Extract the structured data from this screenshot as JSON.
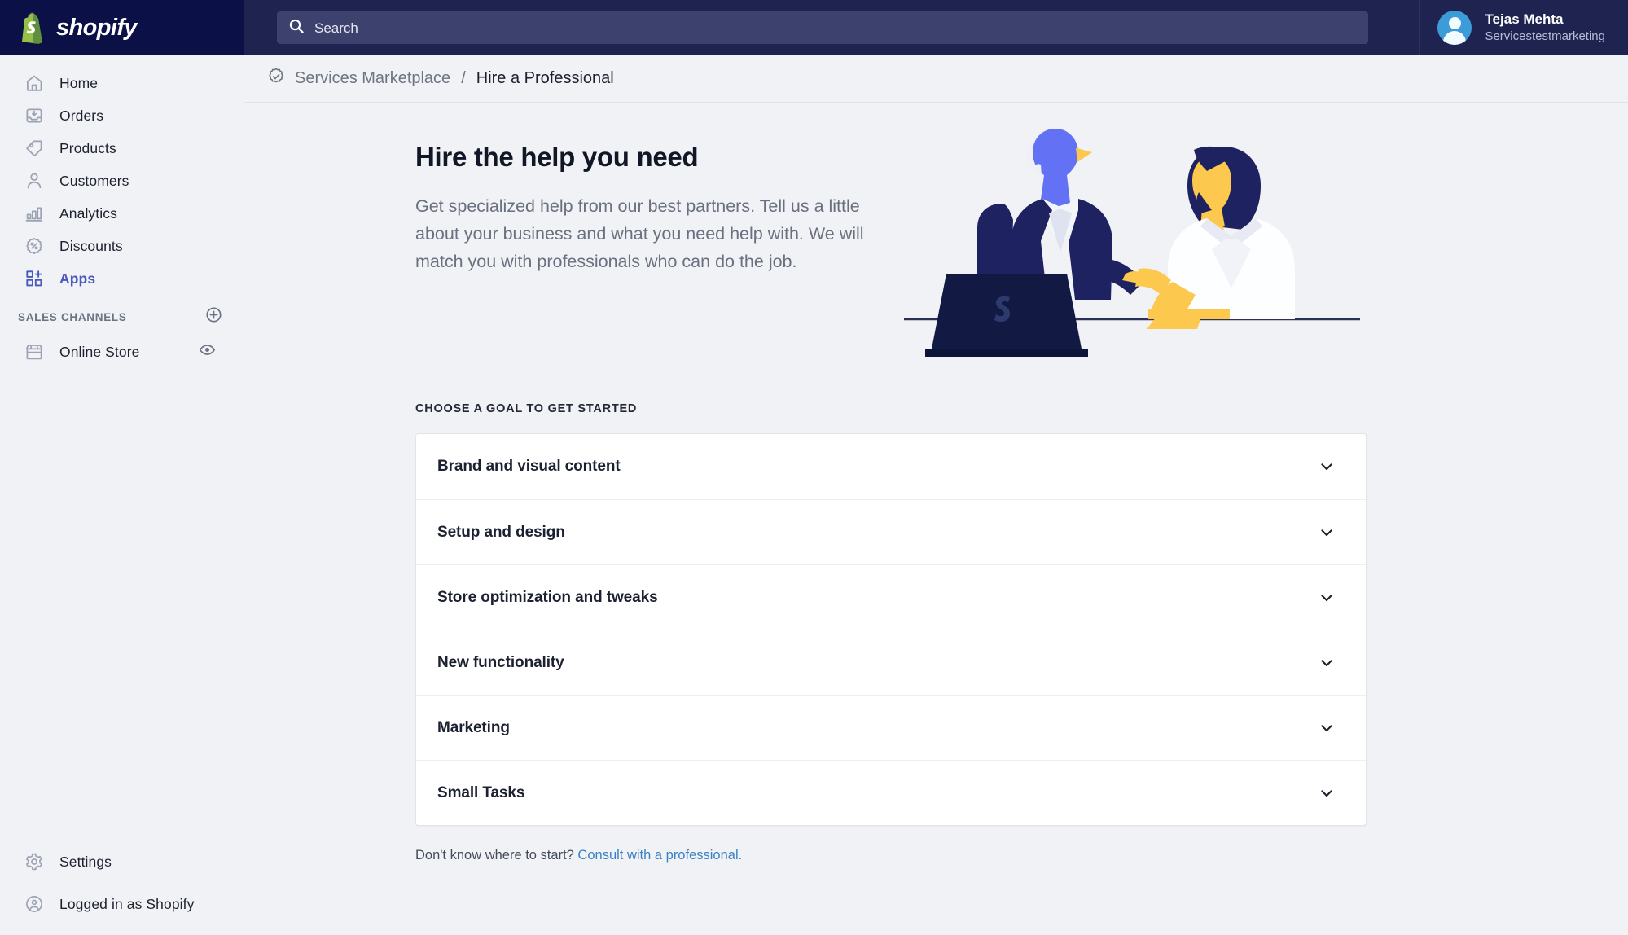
{
  "brand": {
    "name": "shopify",
    "logo_icon": "shopify-bag-icon",
    "topbar_color": "#1f2350",
    "logo_panel_color": "#0b1046",
    "accent_color": "#4959bd",
    "link_color": "#3b82c4",
    "page_background": "#f1f2f5"
  },
  "search": {
    "placeholder": "Search",
    "value": "",
    "icon": "search-icon"
  },
  "user": {
    "name": "Tejas Mehta",
    "store": "Servicestestmarketing",
    "avatar_icon": "user-avatar-icon"
  },
  "sidebar": {
    "items": [
      {
        "label": "Home",
        "icon": "home-icon",
        "active": false
      },
      {
        "label": "Orders",
        "icon": "orders-icon",
        "active": false
      },
      {
        "label": "Products",
        "icon": "tag-icon",
        "active": false
      },
      {
        "label": "Customers",
        "icon": "person-icon",
        "active": false
      },
      {
        "label": "Analytics",
        "icon": "bar-chart-icon",
        "active": false
      },
      {
        "label": "Discounts",
        "icon": "discount-icon",
        "active": false
      },
      {
        "label": "Apps",
        "icon": "apps-grid-icon",
        "active": true
      }
    ],
    "sales_channels": {
      "title": "SALES CHANNELS",
      "add_icon": "plus-circle-icon",
      "items": [
        {
          "label": "Online Store",
          "icon": "storefront-icon",
          "action_icon": "eye-icon"
        }
      ]
    },
    "bottom_items": [
      {
        "label": "Settings",
        "icon": "gear-icon"
      },
      {
        "label": "Logged in as Shopify",
        "icon": "account-circle-icon"
      }
    ]
  },
  "breadcrumb": {
    "icon": "verified-badge-icon",
    "parent": "Services Marketplace",
    "separator": "/",
    "current": "Hire a Professional"
  },
  "hero": {
    "title": "Hire the help you need",
    "description": "Get specialized help from our best partners. Tell us a little about your business and what you need help with. We will match you with professionals who can do the job.",
    "illustration": "two-people-at-laptop-illustration",
    "illustration_colors": {
      "navy": "#1f2260",
      "purple": "#6371f5",
      "light_purple": "#8f9bff",
      "yellow": "#fcc94e",
      "white": "#ffffff",
      "hair_light": "#eef0f6"
    }
  },
  "goals": {
    "heading": "CHOOSE A GOAL TO GET STARTED",
    "items": [
      {
        "label": "Brand and visual content",
        "expanded": false,
        "chevron": "chevron-down-icon"
      },
      {
        "label": "Setup and design",
        "expanded": false,
        "chevron": "chevron-down-icon"
      },
      {
        "label": "Store optimization and tweaks",
        "expanded": false,
        "chevron": "chevron-down-icon"
      },
      {
        "label": "New functionality",
        "expanded": false,
        "chevron": "chevron-down-icon"
      },
      {
        "label": "Marketing",
        "expanded": false,
        "chevron": "chevron-down-icon"
      },
      {
        "label": "Small Tasks",
        "expanded": false,
        "chevron": "chevron-down-icon"
      }
    ]
  },
  "footnote": {
    "text": "Don't know where to start?",
    "link_label": "Consult with a professional."
  }
}
